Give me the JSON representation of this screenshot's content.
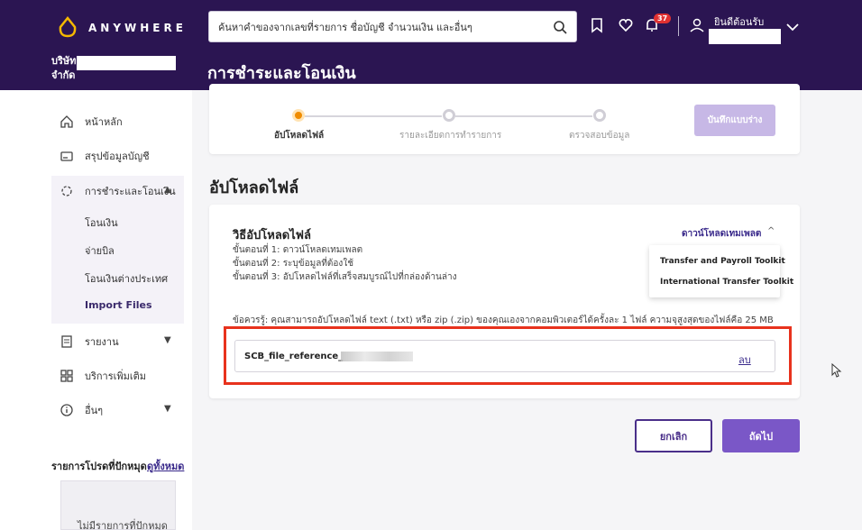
{
  "app": {
    "logo_text": "ANYWHERE",
    "company_prefix": "บริษัท",
    "company_suffix": "จำกัด"
  },
  "header": {
    "search_placeholder": "ค้นหาคำของจากเลขที่รายการ ชื่อบัญชี จำนวนเงิน และอื่นๆ",
    "notification_count": "37",
    "welcome": "ยินดีต้อนรับ"
  },
  "page": {
    "title": "การชำระและโอนเงิน"
  },
  "sidebar": {
    "items": [
      {
        "label": "หน้าหลัก",
        "icon": "home-icon"
      },
      {
        "label": "สรุปข้อมูลบัญชี",
        "icon": "account-icon"
      },
      {
        "label": "การชำระและโอนเงิน",
        "icon": "transfer-icon"
      },
      {
        "label": "รายงาน",
        "icon": "report-icon"
      },
      {
        "label": "บริการเพิ่มเติม",
        "icon": "grid-icon"
      },
      {
        "label": "อื่นๆ",
        "icon": "info-icon"
      }
    ],
    "sub_items": [
      "โอนเงิน",
      "จ่ายบิล",
      "โอนเงินต่างประเทศ",
      "Import Files"
    ],
    "favorites_title": "รายการโปรดที่ปักหมุด",
    "favorites_link": "ดูทั้งหมด",
    "favorites_empty": "ไม่มีรายการที่ปักหมุด"
  },
  "stepper": {
    "steps": [
      "อัปโหลดไฟล์",
      "รายละเอียดการทำรายการ",
      "ตรวจสอบข้อมูล"
    ],
    "draft_button": "บันทึกแบบร่าง"
  },
  "upload": {
    "section_title": "อัปโหลดไฟล์",
    "method_title": "วิธีอัปโหลดไฟล์",
    "steps": [
      "ขั้นตอนที่ 1: ดาวน์โหลดเทมเพลต",
      "ขั้นตอนที่ 2: ระบุข้อมูลที่ต้องใช้",
      "ขั้นตอนที่ 3: อัปโหลดไฟล์ที่เสร็จสมบูรณ์ไปที่กล่องด้านล่าง"
    ],
    "download_template": "ดาวน์โหลดเทมเพลต",
    "template_options": [
      "Transfer and Payroll Toolkit",
      "International Transfer Toolkit"
    ],
    "note": "ข้อควรรู้: คุณสามารถอัปโหลดไฟล์ text (.txt) หรือ zip (.zip) ของคุณเองจากคอมพิวเตอร์ได้ครั้งละ 1 ไฟล์ ความจุสูงสุดของไฟล์คือ 25 MB",
    "file_name": "SCB_file_reference_",
    "delete_label": "ลบ"
  },
  "actions": {
    "cancel": "ยกเลิก",
    "next": "ถัดไป"
  },
  "colors": {
    "header_bg": "#2b1552",
    "accent": "#7a57c7",
    "highlight": "#e8321d",
    "active_step": "#f08c00"
  }
}
